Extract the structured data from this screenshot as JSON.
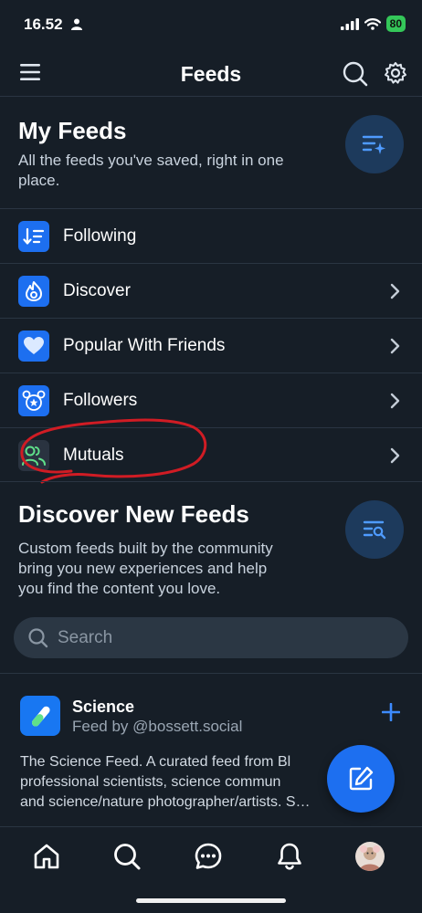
{
  "status": {
    "time": "16.52",
    "battery": "80"
  },
  "header": {
    "title": "Feeds"
  },
  "my_feeds": {
    "title": "My Feeds",
    "subtitle_line1": "All the feeds you've saved, right in one",
    "subtitle_line2": "place.",
    "items": [
      {
        "label": "Following",
        "icon": "following-icon",
        "color": "#1d6ff0"
      },
      {
        "label": "Discover",
        "icon": "discover-icon",
        "color": "#1d6ff0"
      },
      {
        "label": "Popular With Friends",
        "icon": "heart-icon",
        "color": "#1d6ff0"
      },
      {
        "label": "Followers",
        "icon": "followers-icon",
        "color": "#1d6ff0"
      },
      {
        "label": "Mutuals",
        "icon": "mutuals-icon",
        "color": "#2a3340"
      }
    ]
  },
  "discover": {
    "title": "Discover New Feeds",
    "subtitle_line1": "Custom feeds built by the community",
    "subtitle_line2": "bring you new experiences and help",
    "subtitle_line3": "you find the content you love."
  },
  "search": {
    "placeholder": "Search"
  },
  "feed_card": {
    "title": "Science",
    "by": "Feed by @bossett.social",
    "desc_line1": "The Science Feed. A curated feed from Bl",
    "desc_line2": "professional scientists,  science commun",
    "desc_line3": "and science/nature photographer/artists. S…"
  },
  "colors": {
    "accent": "#1d6ff0",
    "background": "#161e27",
    "annotation": "#d01c24"
  }
}
